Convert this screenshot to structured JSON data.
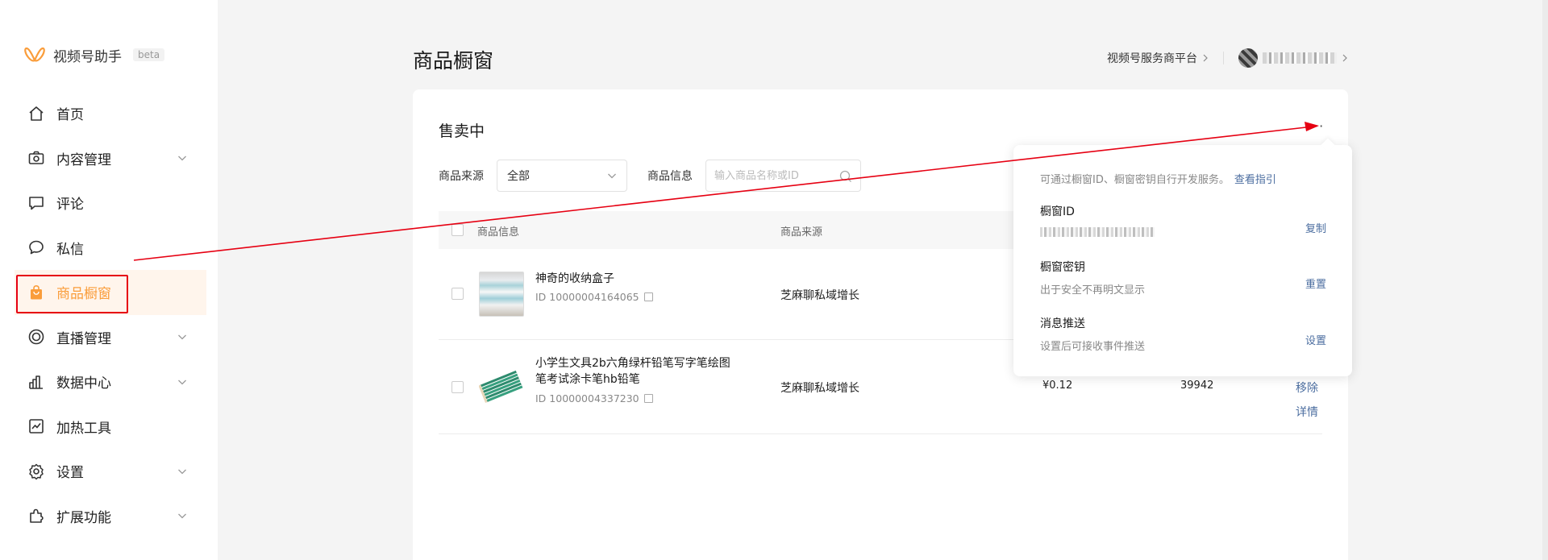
{
  "app": {
    "name": "视频号助手",
    "badge": "beta"
  },
  "sidebar": {
    "items": [
      {
        "label": "首页",
        "icon": "home-icon",
        "expandable": false
      },
      {
        "label": "内容管理",
        "icon": "camera-icon",
        "expandable": true
      },
      {
        "label": "评论",
        "icon": "comment-icon",
        "expandable": false
      },
      {
        "label": "私信",
        "icon": "message-icon",
        "expandable": false
      },
      {
        "label": "商品橱窗",
        "icon": "shopping-bag-icon",
        "expandable": false,
        "active": true
      },
      {
        "label": "直播管理",
        "icon": "live-icon",
        "expandable": true
      },
      {
        "label": "数据中心",
        "icon": "bar-chart-icon",
        "expandable": true
      },
      {
        "label": "加热工具",
        "icon": "trend-icon",
        "expandable": false
      },
      {
        "label": "设置",
        "icon": "gear-icon",
        "expandable": true
      },
      {
        "label": "扩展功能",
        "icon": "puzzle-icon",
        "expandable": true
      }
    ]
  },
  "header": {
    "title": "商品橱窗",
    "service_link": "视频号服务商平台"
  },
  "card": {
    "title": "售卖中",
    "more": "···",
    "filters": {
      "source_label": "商品来源",
      "source_value": "全部",
      "info_label": "商品信息",
      "search_placeholder": "输入商品名称或ID"
    },
    "table": {
      "headers": {
        "info": "商品信息",
        "source": "商品来源"
      },
      "rows": [
        {
          "name": "神奇的收纳盒子",
          "id": "ID 10000004164065",
          "source": "芝麻聊私域增长"
        },
        {
          "name": "小学生文具2b六角绿杆铅笔写字笔绘图笔考试涂卡笔hb铅笔",
          "id": "ID 10000004337230",
          "source": "芝麻聊私域增长",
          "price": "¥0.12",
          "stock": "39942",
          "actions": [
            "移除",
            "详情"
          ]
        }
      ]
    }
  },
  "popover": {
    "desc": "可通过橱窗ID、橱窗密钥自行开发服务。",
    "desc_link": "查看指引",
    "sections": [
      {
        "title": "橱窗ID",
        "sub": "",
        "action": "复制"
      },
      {
        "title": "橱窗密钥",
        "sub": "出于安全不再明文显示",
        "action": "重置"
      },
      {
        "title": "消息推送",
        "sub": "设置后可接收事件推送",
        "action": "设置"
      }
    ]
  },
  "colors": {
    "accent": "#fa9d3b",
    "link": "#4c6ea0",
    "annotation": "#e60012"
  }
}
